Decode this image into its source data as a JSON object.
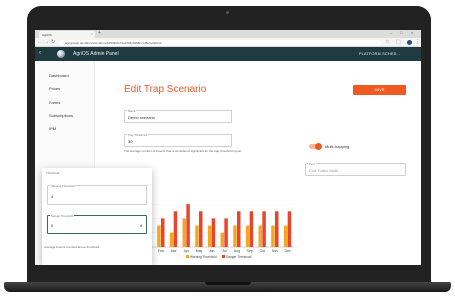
{
  "browser": {
    "tab_title": "AgriOS",
    "new_tab": "+",
    "url": "agrigptapp.dev/farm/scenario/edit/9f3b8a74e2d18c0a55b7c46efac92d13",
    "window_controls": [
      "–",
      "□",
      "×"
    ]
  },
  "app": {
    "title": "AgriOS Admin Panel",
    "platform_label": "PLATFORM  SCHED..."
  },
  "sidebar": {
    "items": [
      {
        "label": "Dashboard"
      },
      {
        "label": "Prices"
      },
      {
        "label": "Farms"
      },
      {
        "label": "Subscriptions"
      },
      {
        "label": "IPM"
      }
    ]
  },
  "page": {
    "title": "Edit Trap Scenario",
    "save_label": "SAVE"
  },
  "form": {
    "name": {
      "label": "Name",
      "value": "Demo scenario"
    },
    "trap_threshold": {
      "label": "Trap Threshold",
      "value": "30"
    },
    "helper_text": "The average number of insects that is considered significant for the trap-threshold report.",
    "toggle_label": "Multi-trapping",
    "pest_field": {
      "label": "Pest",
      "placeholder": "Cod Tortrix Moth"
    }
  },
  "overlay": {
    "title": "Threshold",
    "warning_label": "Warning Threshold",
    "warning_value": "4",
    "danger_label": "Danger Threshold",
    "danger_value": "5",
    "danger_suffix": "8",
    "note": "Average insects counted above threshold"
  },
  "colors": {
    "accent": "#f05a22",
    "header": "#1f3a40",
    "warning_bar": "#f5a623",
    "danger_bar": "#e8452c"
  },
  "chart_data": {
    "type": "bar",
    "categories": [
      "Jan",
      "Feb",
      "Mar",
      "Apr",
      "May",
      "Jun",
      "Jul",
      "Aug",
      "Sep",
      "Oct",
      "Nov",
      "Dec"
    ],
    "series": [
      {
        "name": "Warning Threshold",
        "values": [
          2,
          3,
          2,
          4,
          3,
          3,
          2,
          3,
          3,
          3,
          3,
          3
        ],
        "color": "#f5a623"
      },
      {
        "name": "Danger Threshold",
        "values": [
          3,
          4,
          5,
          6,
          5,
          4,
          4,
          5,
          5,
          5,
          5,
          5
        ],
        "color": "#e8452c"
      }
    ],
    "yticks": [
      "0",
      "2",
      "4",
      "6"
    ],
    "ylim": [
      0,
      7
    ],
    "legend_position": "bottom"
  }
}
